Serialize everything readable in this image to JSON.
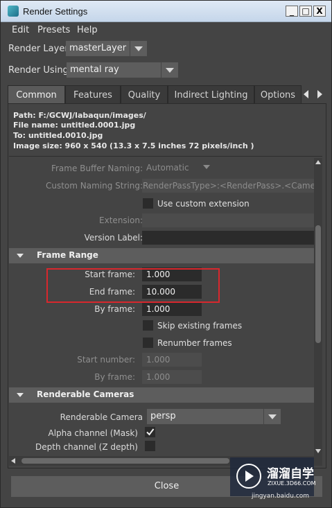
{
  "window": {
    "title": "Render Settings",
    "minimize": "_",
    "maximize": "□",
    "close": "X"
  },
  "menu": [
    "Edit",
    "Presets",
    "Help"
  ],
  "render_layer": {
    "label": "Render Layer",
    "value": "masterLayer"
  },
  "render_using": {
    "label": "Render Using",
    "value": "mental ray"
  },
  "tabs": [
    "Common",
    "Features",
    "Quality",
    "Indirect Lighting",
    "Options"
  ],
  "info": {
    "path": "Path: F:/GCWJ/labaqun/images/",
    "file_name": "File name:  untitled.0001.jpg",
    "to": "To:           untitled.0010.jpg",
    "image_size": "Image size: 960 x 540 (13.3 x 7.5 inches 72 pixels/inch )"
  },
  "settings": {
    "frame_buffer_naming": {
      "label": "Frame Buffer Naming:",
      "value": "Automatic"
    },
    "custom_naming_string": {
      "label": "Custom Naming String:",
      "value": "RenderPassType>:<RenderPass>.<Camera"
    },
    "use_custom_extension": "Use custom extension",
    "extension_label": "Extension:",
    "version_label": "Version Label:"
  },
  "frame_range": {
    "title": "Frame Range",
    "start_label": "Start frame:",
    "start_value": "1.000",
    "end_label": "End frame:",
    "end_value": "10.000",
    "by_label": "By frame:",
    "by_value": "1.000",
    "skip_existing": "Skip existing frames",
    "renumber": "Renumber frames",
    "start_number_label": "Start number:",
    "start_number_value": "1.000",
    "by_frame2_label": "By frame:",
    "by_frame2_value": "1.000"
  },
  "renderable_cameras": {
    "title": "Renderable Cameras",
    "camera_label": "Renderable Camera",
    "camera_value": "persp",
    "alpha_label": "Alpha channel (Mask)",
    "depth_label": "Depth channel (Z depth)"
  },
  "close_button": "Close",
  "watermark": {
    "brand": "溜溜自学",
    "sub": "ZIXUE.3D66.COM",
    "url": "jingyan.baidu.com"
  },
  "colors": {
    "highlight_box": "#d9272d",
    "field_bg": "#2b2b2b",
    "panel_bg": "#444444"
  }
}
